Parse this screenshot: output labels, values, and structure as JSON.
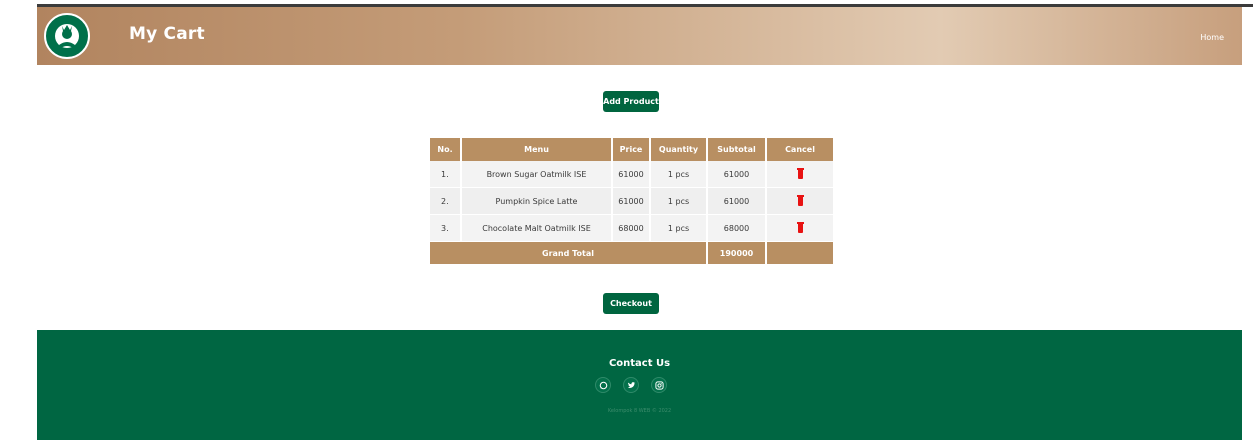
{
  "header": {
    "title": "My Cart",
    "nav_home": "Home"
  },
  "actions": {
    "add_product": "Add Product",
    "checkout": "Checkout"
  },
  "table": {
    "columns": [
      "No.",
      "Menu",
      "Price",
      "Quantity",
      "Subtotal",
      "Cancel"
    ],
    "rows": [
      {
        "no": "1.",
        "menu": "Brown Sugar Oatmilk ISE",
        "price": "61000",
        "quantity": "1 pcs",
        "subtotal": "61000"
      },
      {
        "no": "2.",
        "menu": "Pumpkin Spice Latte",
        "price": "61000",
        "quantity": "1 pcs",
        "subtotal": "61000"
      },
      {
        "no": "3.",
        "menu": "Chocolate Malt Oatmilk ISE",
        "price": "68000",
        "quantity": "1 pcs",
        "subtotal": "68000"
      }
    ],
    "grand_total_label": "Grand Total",
    "grand_total_value": "190000",
    "cancel_icon": "trash-icon"
  },
  "footer": {
    "contact_title": "Contact Us",
    "socials": [
      "whatsapp-icon",
      "twitter-icon",
      "instagram-icon"
    ],
    "copyright": "Kelompok 8 WEB © 2022"
  },
  "colors": {
    "brand_green": "#00653f",
    "header_tan": "#b88f62",
    "cancel_red": "#e81212"
  }
}
